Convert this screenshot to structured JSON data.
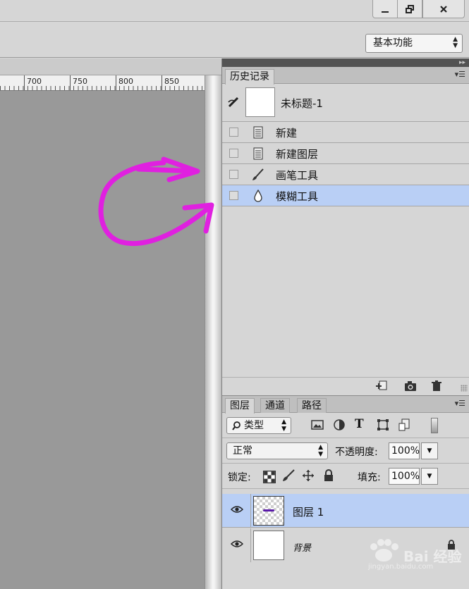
{
  "window": {
    "controls": {
      "minimize": "minimize",
      "restore": "restore",
      "close": "close"
    }
  },
  "options_bar": {
    "workspace": "基本功能"
  },
  "ruler": {
    "labels": [
      "700",
      "750",
      "800",
      "850"
    ]
  },
  "history_panel": {
    "tab": "历史记录",
    "snapshot": "未标题-1",
    "states": [
      {
        "label": "新建",
        "icon": "document-icon",
        "selected": false
      },
      {
        "label": "新建图层",
        "icon": "document-icon",
        "selected": false
      },
      {
        "label": "画笔工具",
        "icon": "brush-icon",
        "selected": false
      },
      {
        "label": "模糊工具",
        "icon": "blur-drop-icon",
        "selected": true
      }
    ]
  },
  "layers_panel": {
    "tabs": [
      "图层",
      "通道",
      "路径"
    ],
    "filter_kind": "类型",
    "blend_mode": "正常",
    "opacity_label": "不透明度:",
    "opacity_value": "100%",
    "lock_label": "锁定:",
    "fill_label": "填充:",
    "fill_value": "100%",
    "layers": [
      {
        "name": "图层 1",
        "selected": true,
        "visible": true
      },
      {
        "name": "背景",
        "selected": false,
        "visible": true,
        "locked": true
      }
    ]
  },
  "watermark": {
    "text": "Bai 经验",
    "sub": "jingyan.baidu.com"
  },
  "colors": {
    "selection": "#b9cff5",
    "annotation": "#e020e0",
    "canvas_bg": "#999999"
  }
}
